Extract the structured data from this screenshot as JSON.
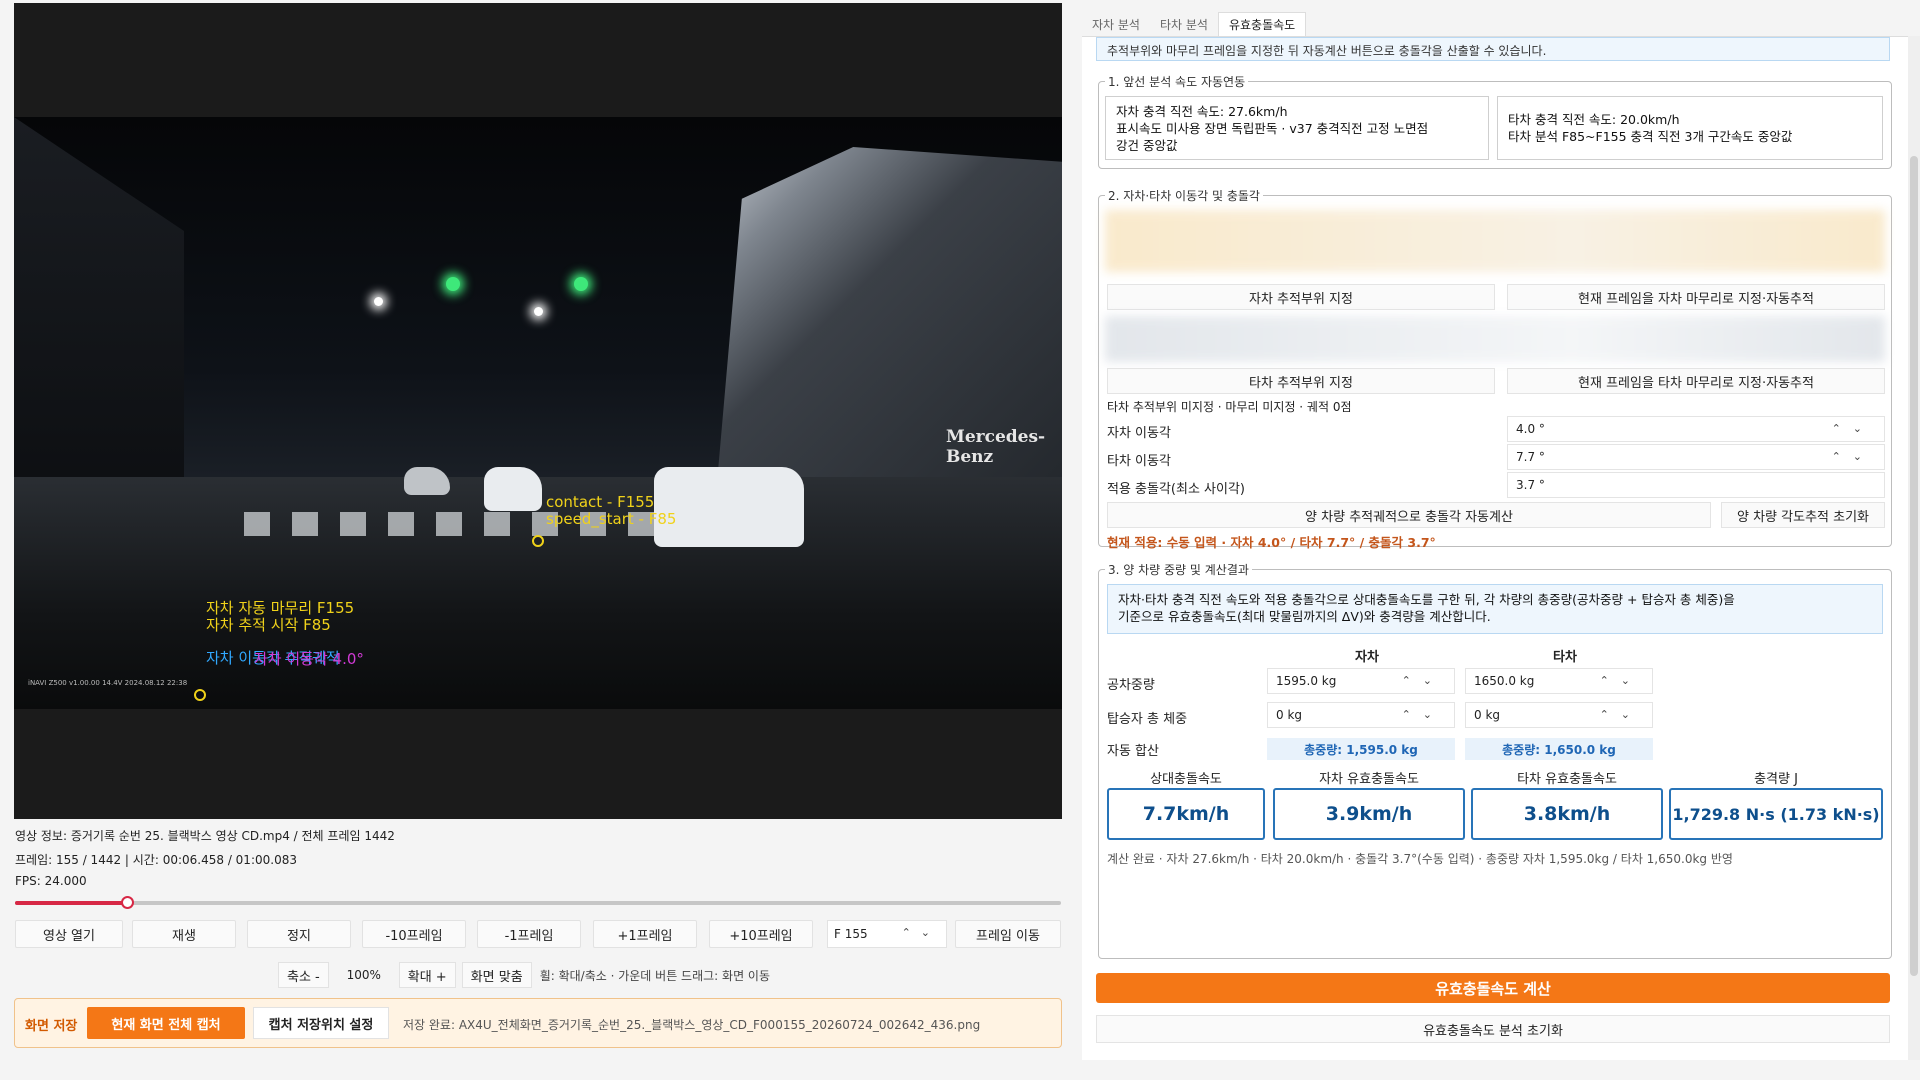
{
  "video": {
    "overlay": {
      "contact": "contact - F155",
      "speed_start": "speed_start - F85",
      "self_end": "자차 자동 마무리 F155",
      "self_track_start": "자차 추적 시작 F85",
      "self_move_track": "자차 이동각 추적궤적",
      "self_move_angle": "자차 이동각 4.0°",
      "brand": "Mercedes-Benz",
      "cam_stamp": "iNAVI Z500  v1.00.00  14.4V      2024.08.12 22:38"
    },
    "info": {
      "video_info": "영상 정보: 증거기록 순번 25. 블랙박스 영상 CD.mp4 / 전체 프레임 1442",
      "frame_time": "프레임: 155 / 1442 | 시간: 00:06.458 / 01:00.083",
      "fps": "FPS: 24.000"
    },
    "progress": 0.107
  },
  "controls": {
    "open": "영상 열기",
    "play": "재생",
    "stop": "정지",
    "minus10": "-10프레임",
    "minus1": "-1프레임",
    "plus1": "+1프레임",
    "plus10": "+10프레임",
    "frame_value": "F 155",
    "frame_move": "프레임 이동",
    "zoom_out": "축소 -",
    "zoom_level": "100%",
    "zoom_in": "확대 +",
    "fit": "화면 맞춤",
    "wheel_hint": "휠: 확대/축소 · 가운데 버튼 드래그: 화면 이동"
  },
  "capture": {
    "label": "화면 저장",
    "capture_full": "현재 화면 전체 캡처",
    "set_location": "캡처 저장위치 설정",
    "status": "저장 완료: AX4U_전체화면_증거기록_순번_25._블랙박스_영상_CD_F000155_20260724_002642_436.png"
  },
  "tabs": [
    "자차 분석",
    "타차 분석",
    "유효충돌속도"
  ],
  "panel": {
    "hint": "추적부위와 마무리 프레임을 지정한 뒤 자동계산 버튼으로 충돌각을 산출할 수 있습니다.",
    "section1": {
      "title": "1. 앞선 분석 속도 자동연동",
      "self_line1": "자차 충격 직전 속도: 27.6km/h",
      "self_line2": "표시속도 미사용 장면 독립판독 · v37 충격직전 고정 노면점",
      "self_line3": "강건 중앙값",
      "other_line1": "타차 충격 직전 속도: 20.0km/h",
      "other_line2": "타차 분석 F85~F155 충격 직전 3개 구간속도 중앙값"
    },
    "section2": {
      "title": "2. 자차·타차 이동각 및 충돌각",
      "self_track_btn": "자차 추적부위 지정",
      "self_end_btn": "현재 프레임을 자차 마무리로 지정·자동추적",
      "other_track_btn": "타차 추적부위 지정",
      "other_end_btn": "현재 프레임을 타차 마무리로 지정·자동추적",
      "other_status": "타차 추적부위 미지정 · 마무리 미지정 · 궤적 0점",
      "self_angle_label": "자차 이동각",
      "self_angle_value": "4.0 °",
      "other_angle_label": "타차 이동각",
      "other_angle_value": "7.7 °",
      "applied_label": "적용 충돌각(최소 사이각)",
      "applied_value": "3.7 °",
      "auto_calc_btn": "양 차량 추적궤적으로 충돌각 자동계산",
      "reset_track_btn": "양 차량 각도추적 초기화",
      "current": "현재 적용: 수동 입력 · 자차 4.0° / 타차 7.7° / 충돌각 3.7°"
    },
    "section3": {
      "title": "3. 양 차량 중량 및 계산결과",
      "desc_line1": "자차·타차 충격 직전 속도와 적용 충돌각으로 상대충돌속도를 구한 뒤, 각 차량의 총중량(공차중량 + 탑승자 총 체중)을",
      "desc_line2": "기준으로 유효충돌속도(최대 맞물림까지의 ΔV)와 충격량을 계산합니다.",
      "col_self": "자차",
      "col_other": "타차",
      "curb_label": "공차중량",
      "curb_self": "1595.0 kg",
      "curb_other": "1650.0 kg",
      "pass_label": "탑승자 총 체중",
      "pass_self": "0 kg",
      "pass_other": "0 kg",
      "sum_label": "자동 합산",
      "sum_self": "총중량: 1,595.0 kg",
      "sum_other": "총중량: 1,650.0 kg",
      "res_rel_head": "상대충돌속도",
      "res_self_head": "자차 유효충돌속도",
      "res_other_head": "타차 유효충돌속도",
      "res_impulse_head": "충격량 J",
      "res_rel": "7.7km/h",
      "res_self": "3.9km/h",
      "res_other": "3.8km/h",
      "res_impulse": "1,729.8 N·s (1.73 kN·s)",
      "status": "계산 완료 · 자차 27.6km/h · 타차 20.0km/h · 충돌각 3.7°(수동 입력) · 총중량 자차 1,595.0kg / 타차 1,650.0kg 반영"
    },
    "calc_btn": "유효충돌속도 계산",
    "reset_btn": "유효충돌속도 분석 초기화"
  },
  "colors": {
    "accent_orange": "#f47716",
    "accent_blue": "#2874b8",
    "seek_red": "#d72845"
  }
}
